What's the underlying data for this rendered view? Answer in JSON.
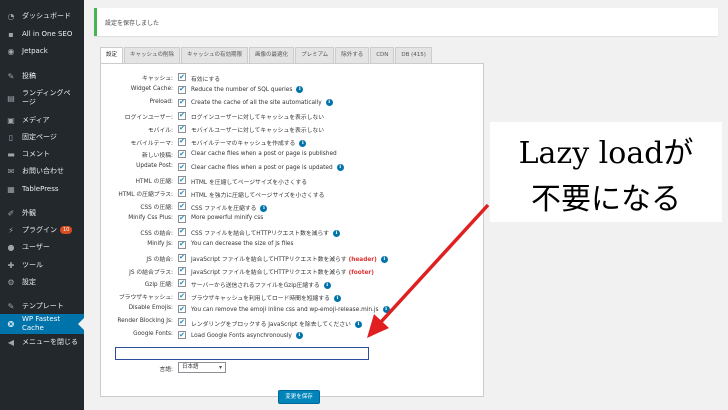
{
  "sidebar": {
    "items": [
      {
        "icon": "dashboard-icon",
        "label": "ダッシュボード"
      },
      {
        "icon": "all-in-one-seo-icon",
        "label": "All in One SEO"
      },
      {
        "icon": "jetpack-icon",
        "label": "Jetpack"
      },
      {
        "icon": "pin-icon",
        "label": "投稿"
      },
      {
        "icon": "landing-page-icon",
        "label": "ランディングページ"
      },
      {
        "icon": "media-icon",
        "label": "メディア"
      },
      {
        "icon": "page-icon",
        "label": "固定ページ"
      },
      {
        "icon": "comment-icon",
        "label": "コメント"
      },
      {
        "icon": "mail-icon",
        "label": "お問い合わせ"
      },
      {
        "icon": "table-icon",
        "label": "TablePress"
      },
      {
        "icon": "brush-icon",
        "label": "外観"
      },
      {
        "icon": "plugin-icon",
        "label": "プラグイン",
        "badge": "10"
      },
      {
        "icon": "user-icon",
        "label": "ユーザー"
      },
      {
        "icon": "wrench-icon",
        "label": "ツール"
      },
      {
        "icon": "settings-icon",
        "label": "設定"
      },
      {
        "icon": "template-icon",
        "label": "テンプレート"
      },
      {
        "icon": "wp-fastest-cache-icon",
        "label": "WP Fastest Cache"
      },
      {
        "icon": "collapse-icon",
        "label": "メニューを閉じる"
      }
    ]
  },
  "notice": {
    "text": "設定を保存しました"
  },
  "tabs": [
    "設定",
    "キャッシュの削除",
    "キャッシュの有効期限",
    "画像の最適化",
    "プレミアム",
    "除外する",
    "CDN",
    "DB (415)"
  ],
  "settings": [
    {
      "label": "キャッシュ:",
      "text": "有効にする",
      "info": false
    },
    {
      "label": "Widget Cache:",
      "text": "Reduce the number of SQL queries",
      "info": true
    },
    {
      "label": "Preload:",
      "text": "Create the cache of all the site automatically",
      "info": true
    },
    {
      "label": "ログインユーザー:",
      "text": "ログインユーザーに対してキャッシュを表示しない",
      "info": false
    },
    {
      "label": "モバイル:",
      "text": "モバイルユーザーに対してキャッシュを表示しない",
      "info": false
    },
    {
      "label": "モバイルテーマ:",
      "text": "モバイルテーマのキャッシュを作成する",
      "info": true
    },
    {
      "label": "新しい投稿:",
      "text": "Clear cache files when a post or page is published",
      "info": false
    },
    {
      "label": "Update Post:",
      "text": "Clear cache files when a post or page is updated",
      "info": true
    },
    {
      "label": "HTML の圧縮:",
      "text": "HTML を圧縮してページサイズを小さくする",
      "info": false
    },
    {
      "label": "HTML の圧縮プラス:",
      "text": "HTML を強力に圧縮してページサイズを小さくする",
      "info": false
    },
    {
      "label": "CSS の圧縮:",
      "text": "CSS ファイルを圧縮する",
      "info": true
    },
    {
      "label": "Minify Css Plus:",
      "text": "More powerful minify css",
      "info": false
    },
    {
      "label": "CSS の結合:",
      "text": "CSS ファイルを結合してHTTPリクエスト数を減らす",
      "info": true
    },
    {
      "label": "Minify Js:",
      "text": "You can decrease the size of js files",
      "info": false
    },
    {
      "label": "JS の結合:",
      "text": "JavaScript ファイルを結合してHTTPリクエスト数を減らす",
      "red": "(header)",
      "info": true
    },
    {
      "label": "JS の結合プラス:",
      "text": "JavaScript ファイルを結合してHTTPリクエスト数を減らす",
      "red": "(footer)",
      "info": false
    },
    {
      "label": "Gzip 圧縮:",
      "text": "サーバーから送信されるファイルをGzip圧縮する",
      "info": true
    },
    {
      "label": "ブラウザキャッシュ:",
      "text": "ブラウザキャッシュを利用してロード時間を短縮する",
      "info": true
    },
    {
      "label": "Disable Emojis:",
      "text": "You can remove the emoji inline css and wp-emoji-release.min.js",
      "info": true
    },
    {
      "label": "Render Blocking Js:",
      "text": "レンダリングをブロックする JavaScript を除去してください",
      "info": true
    },
    {
      "label": "Google Fonts:",
      "text": "Load Google Fonts asynchronously",
      "info": true
    }
  ],
  "language": {
    "label": "言語:",
    "value": "日本語"
  },
  "save_button": "変更を保存",
  "annotation": {
    "line1": "Lazy loadが",
    "line2": "不要になる"
  },
  "colors": {
    "sidebar_bg": "#23282d",
    "active_menu": "#0073aa",
    "notice_border": "#46b450",
    "arrow": "#e02020",
    "highlight_box": "#2a4d9c"
  }
}
